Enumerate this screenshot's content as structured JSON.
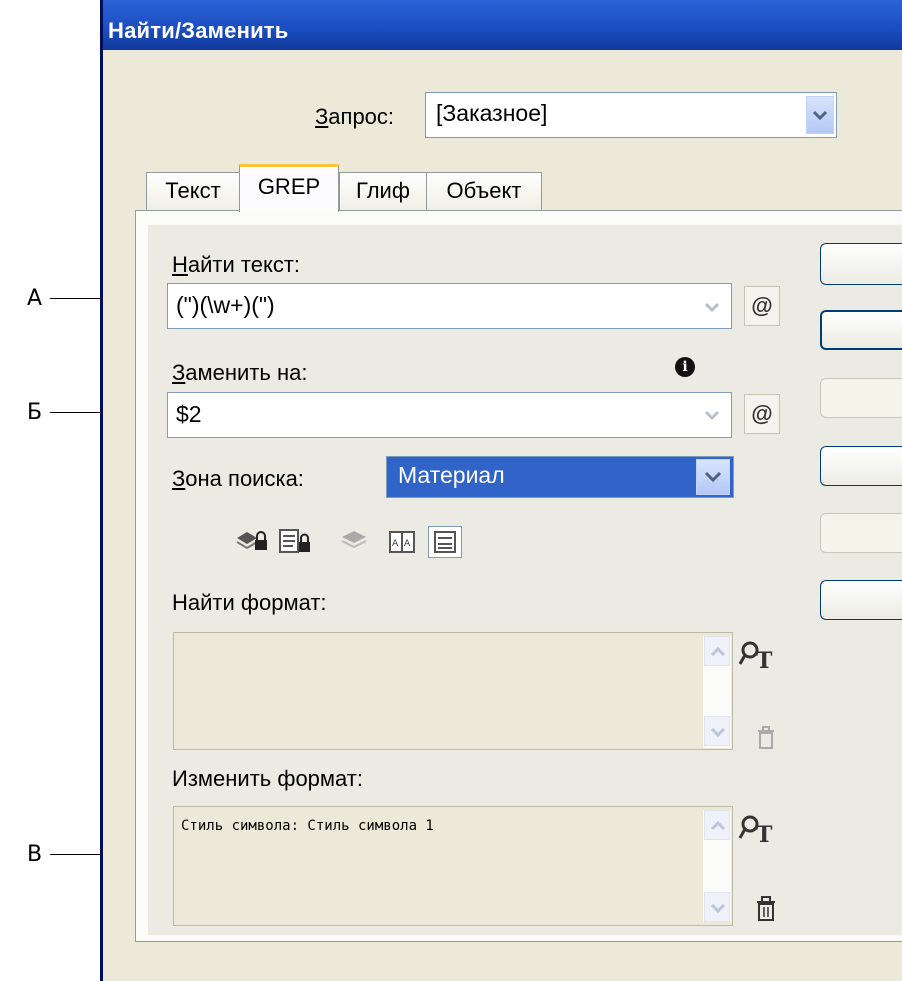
{
  "window": {
    "title": "Найти/Заменить"
  },
  "query": {
    "label": "Запрос:",
    "value": "[Заказное]"
  },
  "tabs": [
    {
      "label": "Текст",
      "active": false
    },
    {
      "label": "GREP",
      "active": true
    },
    {
      "label": "Глиф",
      "active": false
    },
    {
      "label": "Объект",
      "active": false
    }
  ],
  "find_text": {
    "label": "Найти текст:",
    "value": "(\")(\\w+)(\")"
  },
  "replace_with": {
    "label": "Заменить на:",
    "value": "$2"
  },
  "search_zone": {
    "label": "Зона поиска:",
    "value": "Материал"
  },
  "find_format": {
    "label": "Найти формат:",
    "content": ""
  },
  "change_format": {
    "label": "Изменить формат:",
    "content": "Стиль символа: Стиль символа 1"
  },
  "callouts": [
    "А",
    "Б",
    "В"
  ],
  "icons": {
    "special_chars": "@",
    "search_options": [
      "locked-layers-icon",
      "locked-stories-icon",
      "hidden-layers-icon",
      "master-pages-icon",
      "footnotes-icon"
    ],
    "format": "format-settings-icon",
    "clear": "trash-icon",
    "info": "info-icon"
  },
  "colors": {
    "title_bar": "#1a4dbf",
    "dialog_bg": "#ece9d8",
    "selected_zone": "#3164c8",
    "active_tab": "#ffc83c"
  }
}
